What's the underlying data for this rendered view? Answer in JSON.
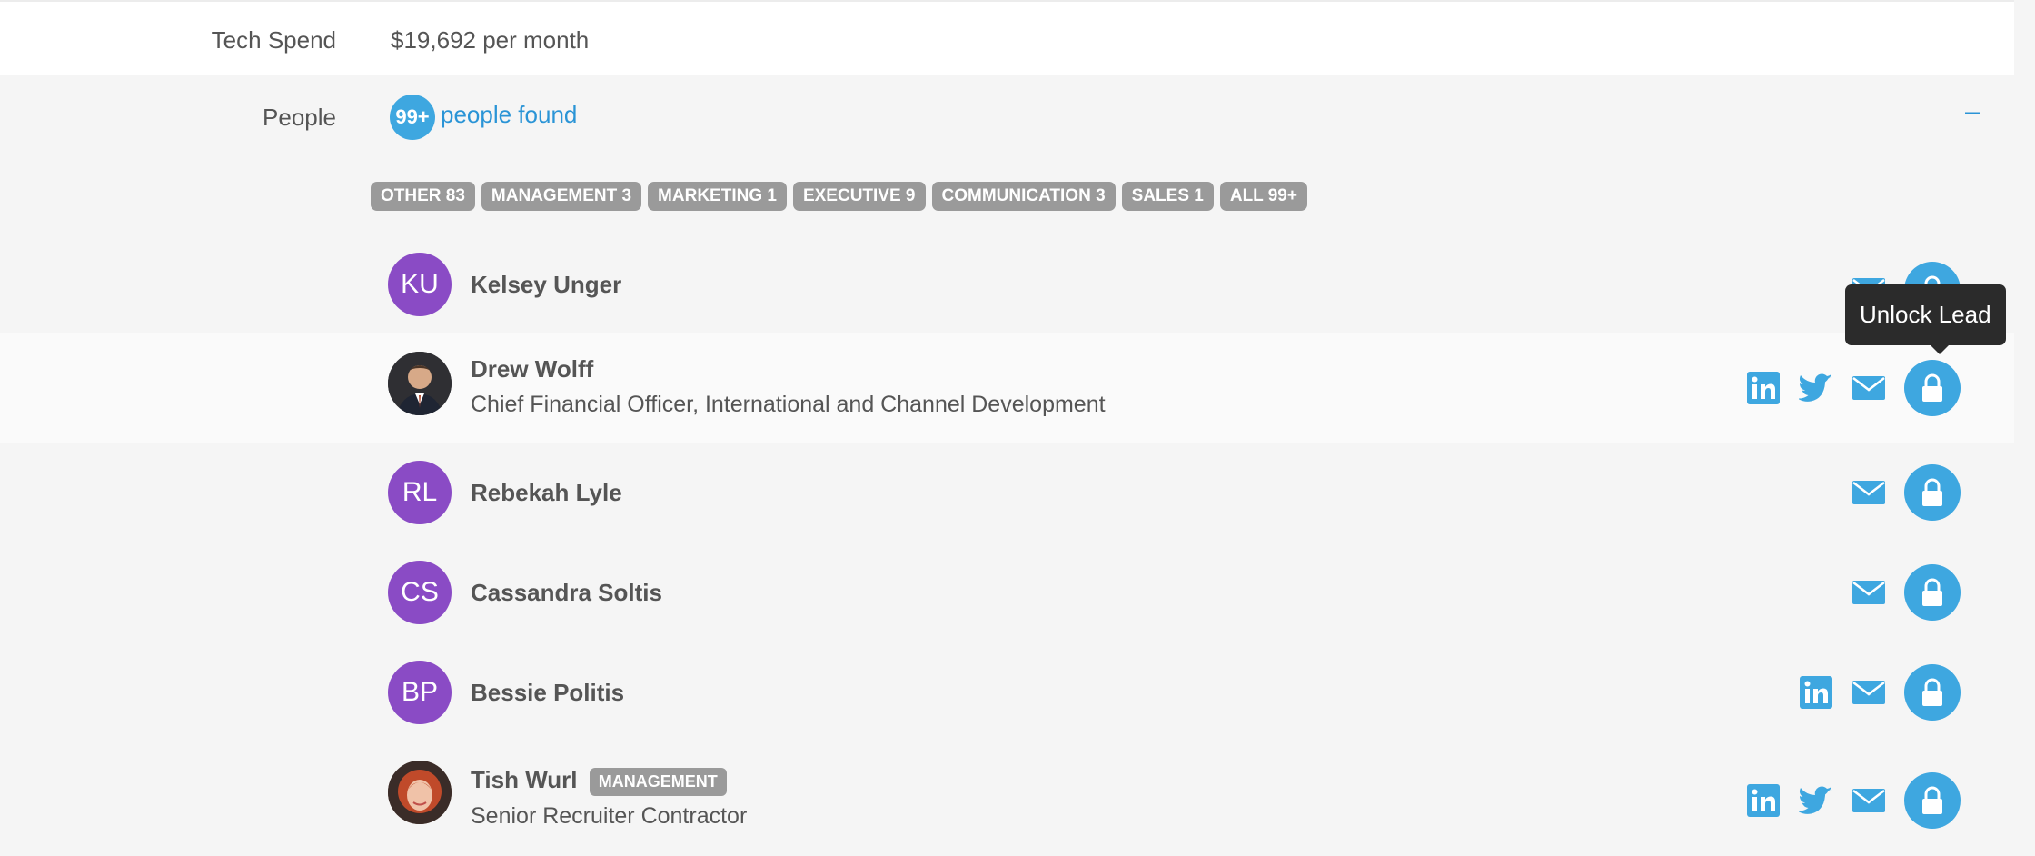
{
  "company": {
    "tech_spend_label": "Tech Spend",
    "tech_spend_value": "$19,692 per month",
    "people_label": "People",
    "people_count_badge": "99+",
    "people_found_text": "people found",
    "collapse_symbol": "–"
  },
  "filters": [
    {
      "label": "OTHER 83"
    },
    {
      "label": "MANAGEMENT 3"
    },
    {
      "label": "MARKETING 1"
    },
    {
      "label": "EXECUTIVE 9"
    },
    {
      "label": "COMMUNICATION 3"
    },
    {
      "label": "SALES 1"
    },
    {
      "label": "ALL 99+"
    }
  ],
  "people": [
    {
      "initials": "KU",
      "name": "Kelsey Unger",
      "title": "",
      "badge": "",
      "icons": [
        "email-icon"
      ]
    },
    {
      "initials": "",
      "name": "Drew Wolff",
      "title": "Chief Financial Officer, International and Channel Development",
      "badge": "",
      "icons": [
        "linkedin-icon",
        "twitter-icon",
        "email-icon"
      ]
    },
    {
      "initials": "RL",
      "name": "Rebekah Lyle",
      "title": "",
      "badge": "",
      "icons": [
        "email-icon"
      ]
    },
    {
      "initials": "CS",
      "name": "Cassandra Soltis",
      "title": "",
      "badge": "",
      "icons": [
        "email-icon"
      ]
    },
    {
      "initials": "BP",
      "name": "Bessie Politis",
      "title": "",
      "badge": "",
      "icons": [
        "linkedin-icon",
        "email-icon"
      ]
    },
    {
      "initials": "",
      "name": "Tish Wurl",
      "title": "Senior Recruiter Contractor",
      "badge": "MANAGEMENT",
      "icons": [
        "linkedin-icon",
        "twitter-icon",
        "email-icon"
      ]
    }
  ],
  "tooltip": {
    "text": "Unlock Lead"
  },
  "colors": {
    "accent": "#3ea7e0",
    "link": "#2a94d6",
    "initials_avatar": "#8a4bc5",
    "chip": "#9a9a9a",
    "tooltip": "#2b2b2b"
  }
}
